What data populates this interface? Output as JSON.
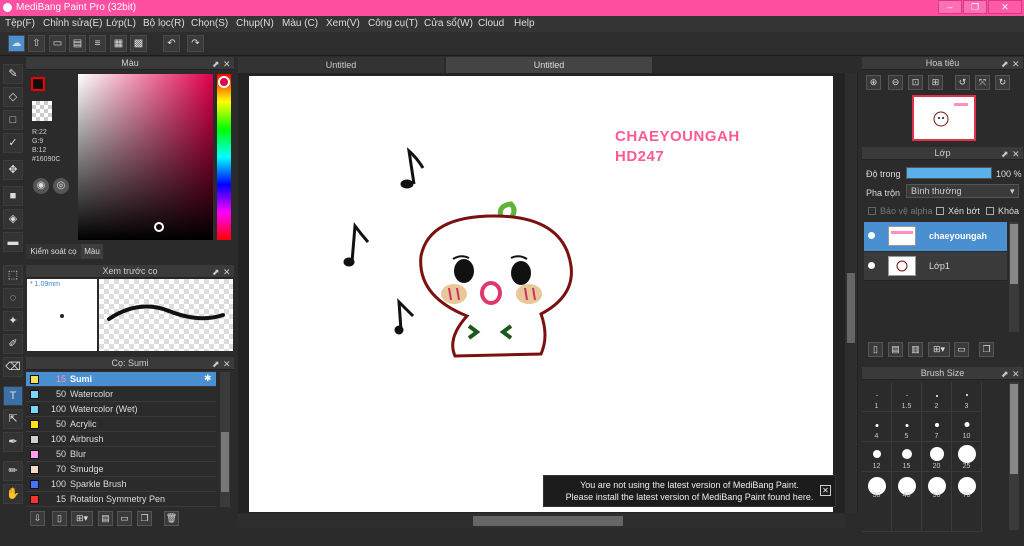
{
  "window": {
    "title": "MediBang Paint Pro (32bit)"
  },
  "menu": [
    "Tệp(F)",
    "Chỉnh sửa(E)",
    "Lớp(L)",
    "Bộ lọc(R)",
    "Chọn(S)",
    "Chụp(N)",
    "Màu (C)",
    "Xem(V)",
    "Công cụ(T)",
    "Cửa sổ(W)",
    "Cloud",
    "Help"
  ],
  "tabs": [
    "Untitled",
    "Untitled"
  ],
  "color_panel": {
    "title": "Màu",
    "r": "R:22",
    "g": "G:9",
    "b": "B:12",
    "hex": "#16090C",
    "tab_brush_control": "Kiểm soát cọ",
    "tab_color": "Màu",
    "fg_color": "#16090C"
  },
  "preview_panel": {
    "title": "Xem trước cọ",
    "size": "1.09mm"
  },
  "brush_panel": {
    "title": "Cọ: Sumi",
    "brushes": [
      {
        "size": "15",
        "name": "Sumi",
        "color": "#f5e05a"
      },
      {
        "size": "50",
        "name": "Watercolor",
        "color": "#7fd4ff"
      },
      {
        "size": "100",
        "name": "Watercolor (Wet)",
        "color": "#7fd4ff"
      },
      {
        "size": "50",
        "name": "Acrylic",
        "color": "#ffe01a"
      },
      {
        "size": "100",
        "name": "Airbrush",
        "color": "#cfcfcf"
      },
      {
        "size": "50",
        "name": "Blur",
        "color": "#ff9ff0"
      },
      {
        "size": "70",
        "name": "Smudge",
        "color": "#f5dcc0"
      },
      {
        "size": "100",
        "name": "Sparkle Brush",
        "color": "#4a6fff"
      },
      {
        "size": "15",
        "name": "Rotation Symmetry Pen",
        "color": "#ff3030"
      }
    ]
  },
  "canvas": {
    "watermark_line1": "CHAEYOUNGAH",
    "watermark_line2": "HD247"
  },
  "notice": {
    "line1": "You are not using the latest version of MediBang Paint.",
    "line2": "Please install the latest version of MediBang Paint found here."
  },
  "navigator": {
    "title": "Hoa tiêu"
  },
  "layer_panel": {
    "title": "Lớp",
    "opacity_label": "Độ trong",
    "opacity_value": "100 %",
    "opacity": 1.0,
    "blend_label": "Pha trộn",
    "blend_value": "Bình thường",
    "protect_alpha": "Bảo vệ alpha",
    "clipping": "Xén bớt",
    "lock": "Khóa",
    "layers": [
      {
        "name": "chaeyoungah",
        "selected": true
      },
      {
        "name": "Lớp1",
        "selected": false
      }
    ]
  },
  "brush_size_panel": {
    "title": "Brush Size",
    "sizes": [
      "1",
      "1.5",
      "2",
      "3",
      "4",
      "5",
      "7",
      "10",
      "12",
      "15",
      "20",
      "25",
      "30",
      "40",
      "50",
      "70"
    ]
  }
}
